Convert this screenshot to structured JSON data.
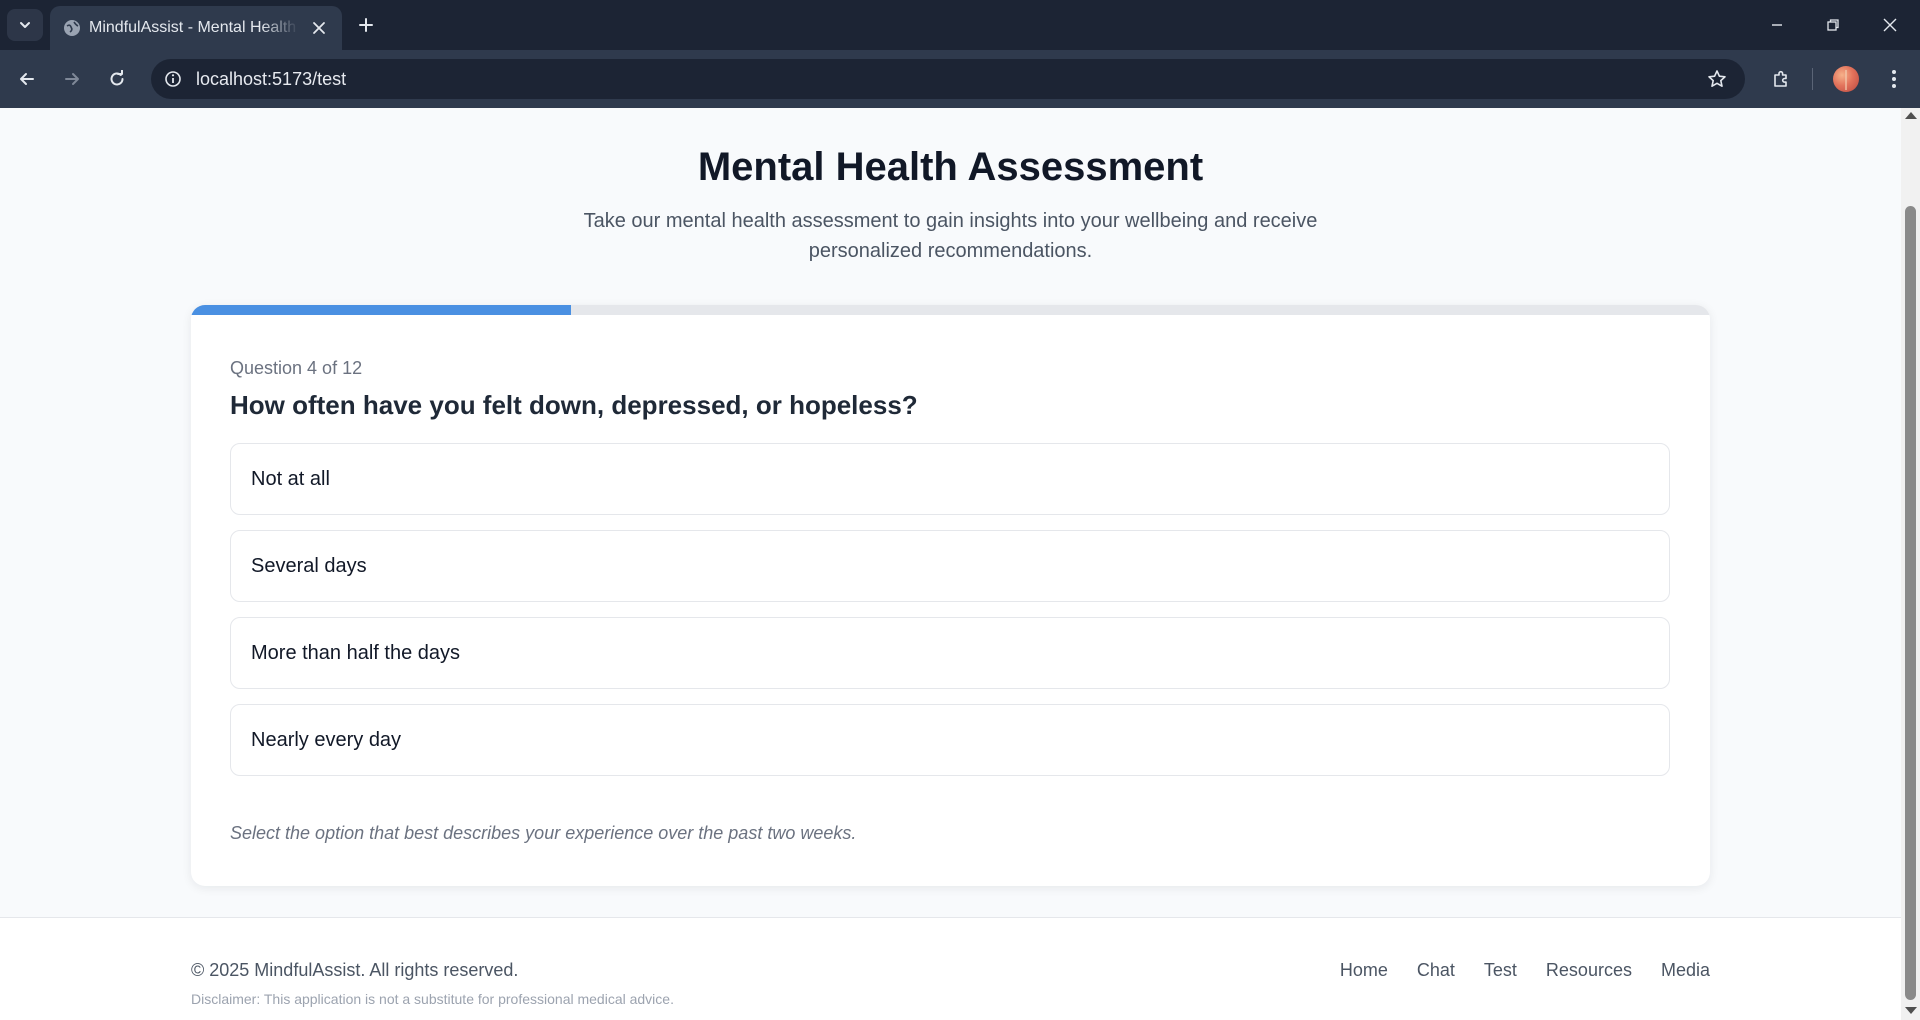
{
  "browser": {
    "tab_title": "MindfulAssist - Mental Health Assessment",
    "url": "localhost:5173/test",
    "icons": [
      "chevron-down-icon",
      "globe-icon",
      "close-icon",
      "plus-icon",
      "minimize-icon",
      "restore-icon",
      "back-icon",
      "forward-icon",
      "reload-icon",
      "info-icon",
      "star-icon",
      "extensions-icon",
      "avatar",
      "kebab-menu-icon"
    ]
  },
  "header": {
    "title": "Mental Health Assessment",
    "subtitle": "Take our mental health assessment to gain insights into your wellbeing and receive personalized recommendations."
  },
  "assessment": {
    "progress_fraction": 0.25,
    "counter": "Question 4 of 12",
    "question": "How often have you felt down, depressed, or hopeless?",
    "options": [
      "Not at all",
      "Several days",
      "More than half the days",
      "Nearly every day"
    ],
    "hint": "Select the option that best describes your experience over the past two weeks."
  },
  "footer": {
    "copyright": "© 2025 MindfulAssist. All rights reserved.",
    "disclaimer": "Disclaimer: This application is not a substitute for professional medical advice.",
    "links": [
      "Home",
      "Chat",
      "Test",
      "Resources",
      "Media"
    ]
  },
  "colors": {
    "accent": "#4a90e2",
    "chrome_dark": "#1c2434",
    "chrome_mid": "#2f3a4d"
  }
}
